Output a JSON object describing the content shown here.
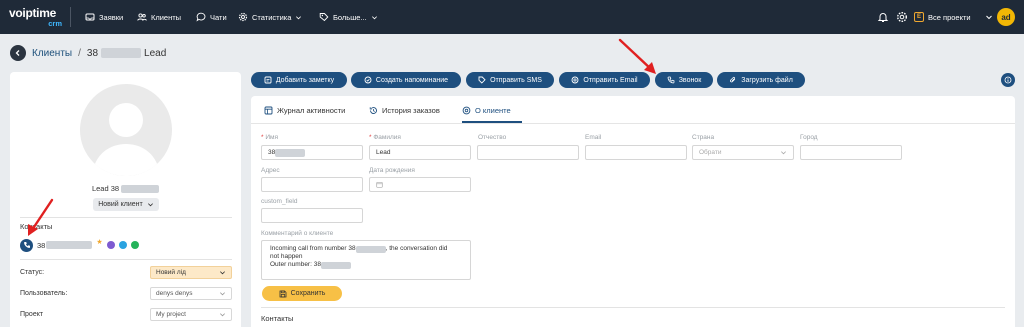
{
  "logo": {
    "main": "voiptime",
    "sub": "crm"
  },
  "nav": [
    {
      "label": "Заявки",
      "icon": "inbox-icon"
    },
    {
      "label": "Клиенты",
      "icon": "users-icon"
    },
    {
      "label": "Чати",
      "icon": "chat-icon"
    },
    {
      "label": "Статистика",
      "icon": "gear-icon"
    },
    {
      "label": "Больше...",
      "icon": "tag-icon"
    }
  ],
  "topbar": {
    "projects_label": "Все проекти",
    "projects_badge": "E",
    "avatar_initials": "ad"
  },
  "breadcrumb": {
    "parent": "Клиенты",
    "separator": "/",
    "current_prefix": "38",
    "current_suffix": "Lead"
  },
  "profile": {
    "name_prefix": "Lead 38",
    "status_pill": "Новий клиент",
    "contacts_heading": "Контакты",
    "phone_prefix": "38",
    "fields": [
      {
        "label": "Статус:",
        "value": "Новий лід"
      },
      {
        "label": "Пользователь:",
        "value": "denys  denys"
      },
      {
        "label": "Проект",
        "value": "My project"
      }
    ]
  },
  "actions": [
    {
      "label": "Добавить заметку"
    },
    {
      "label": "Создать напоминание"
    },
    {
      "label": "Отправить SMS"
    },
    {
      "label": "Отправить Email"
    },
    {
      "label": "Звонок"
    },
    {
      "label": "Загрузить файл"
    }
  ],
  "tabs": [
    {
      "label": "Журнал активности"
    },
    {
      "label": "История заказов"
    },
    {
      "label": "О клиенте"
    }
  ],
  "form": {
    "first_name": {
      "label": "Имя",
      "value": "38"
    },
    "last_name": {
      "label": "Фамилия",
      "value": "Lead"
    },
    "middle_name": {
      "label": "Отчество",
      "value": ""
    },
    "email": {
      "label": "Email",
      "value": ""
    },
    "country": {
      "label": "Страна",
      "placeholder": "Обрати"
    },
    "city": {
      "label": "Город",
      "value": ""
    },
    "address": {
      "label": "Адрес",
      "value": ""
    },
    "birthdate": {
      "label": "Дата рождения",
      "value": ""
    },
    "custom_field": {
      "label": "custom_field",
      "value": ""
    },
    "comment": {
      "label": "Комментарий о клиенте",
      "line1_prefix": "Incoming call from number 38",
      "line1_suffix": ", the conversation did",
      "line2": "not happen",
      "line3_prefix": "Outer number: 38"
    },
    "save_label": "Сохранить"
  },
  "contacts_section": "Контакты",
  "colors": {
    "topbar": "#1f2a38",
    "primary": "#1e4f7f",
    "accent": "#f7c046",
    "arrow": "#e02020"
  }
}
